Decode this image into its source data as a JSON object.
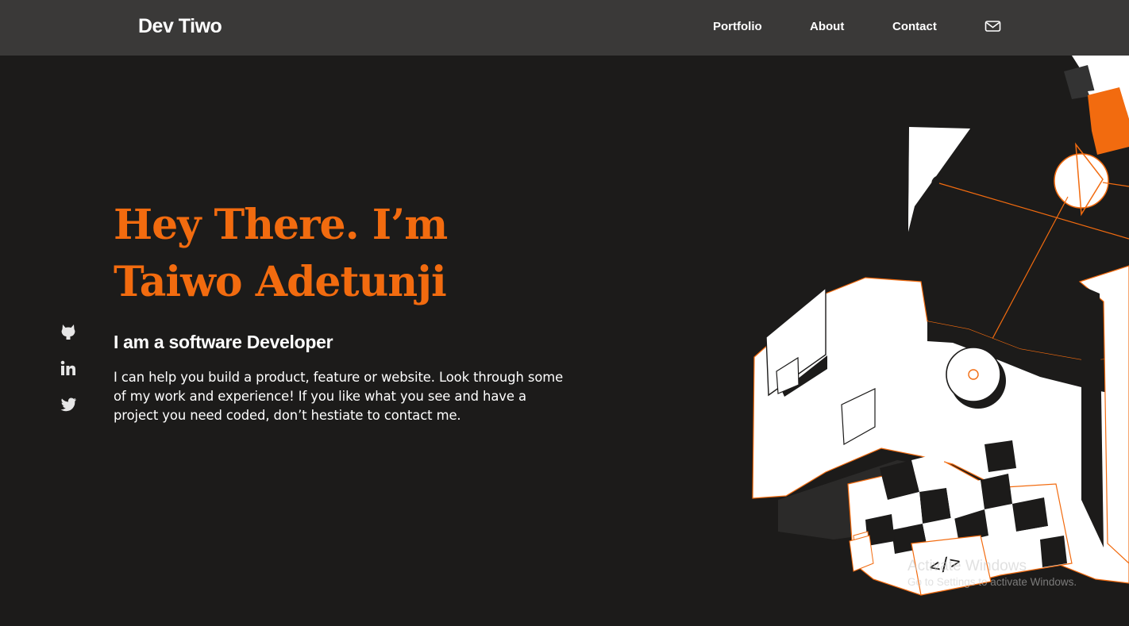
{
  "nav": {
    "brand": "Dev Tiwo",
    "links": [
      {
        "label": "Portfolio"
      },
      {
        "label": "About"
      },
      {
        "label": "Contact"
      }
    ],
    "mail_icon": "mail-icon"
  },
  "hero": {
    "title": "Hey There. I’m Taiwo Adetunji",
    "subtitle": "I am a software Developer",
    "description": "I can help you build a product, feature or website. Look through some of my work and experience! If you like what you see and have a project you need coded, don’t hestiate to contact me."
  },
  "social": [
    {
      "icon": "github-icon"
    },
    {
      "icon": "linkedin-icon"
    },
    {
      "icon": "twitter-icon"
    }
  ],
  "illustration": {
    "code_label": "</>"
  },
  "watermark": {
    "title": "Activate Windows",
    "subtitle": "Go to Settings to activate Windows."
  },
  "colors": {
    "background": "#1c1b1a",
    "navbar": "#3a3938",
    "accent": "#f26b0f",
    "text": "#ffffff"
  }
}
